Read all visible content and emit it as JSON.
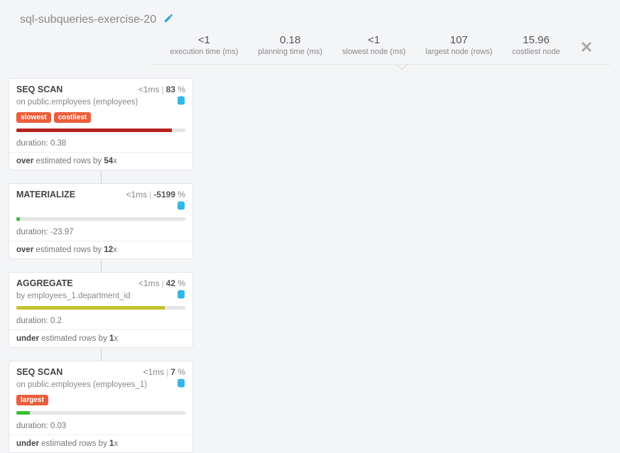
{
  "title": "sql-subqueries-exercise-20",
  "stats": [
    {
      "val": "<1",
      "lbl": "execution time (ms)"
    },
    {
      "val": "0.18",
      "lbl": "planning time (ms)"
    },
    {
      "val": "<1",
      "lbl": "slowest node (ms)"
    },
    {
      "val": "107",
      "lbl": "largest node (rows)"
    },
    {
      "val": "15.96",
      "lbl": "costliest node"
    }
  ],
  "nodes": [
    {
      "op": "SEQ SCAN",
      "time": "<1ms",
      "pct": "83",
      "sub": "on public.employees (employees)",
      "db": true,
      "tags": [
        "slowest",
        "costliest"
      ],
      "bar_color": "bar-red",
      "bar_pct": 92,
      "duration": "duration: 0.38",
      "est_prefix": "over",
      "est_mid": " estimated rows by ",
      "est_val": "54",
      "est_suffix": "x"
    },
    {
      "op": "MATERIALIZE",
      "time": "<1ms",
      "pct": "-5199",
      "sub": "",
      "db": true,
      "tags": [],
      "bar_color": "bar-green",
      "bar_pct": 2,
      "duration": "duration: -23.97",
      "est_prefix": "over",
      "est_mid": " estimated rows by ",
      "est_val": "12",
      "est_suffix": "x"
    },
    {
      "op": "AGGREGATE",
      "time": "<1ms",
      "pct": "42",
      "sub": "by employees_1.department_id",
      "db": true,
      "tags": [],
      "bar_color": "bar-olive",
      "bar_pct": 88,
      "duration": "duration: 0.2",
      "est_prefix": "under",
      "est_mid": " estimated rows by ",
      "est_val": "1",
      "est_suffix": "x"
    },
    {
      "op": "SEQ SCAN",
      "time": "<1ms",
      "pct": "7",
      "sub": "on public.employees (employees_1)",
      "db": true,
      "tags": [
        "largest"
      ],
      "bar_color": "bar-green",
      "bar_pct": 8,
      "duration": "duration: 0.03",
      "est_prefix": "under",
      "est_mid": " estimated rows by ",
      "est_val": "1",
      "est_suffix": "x"
    }
  ]
}
